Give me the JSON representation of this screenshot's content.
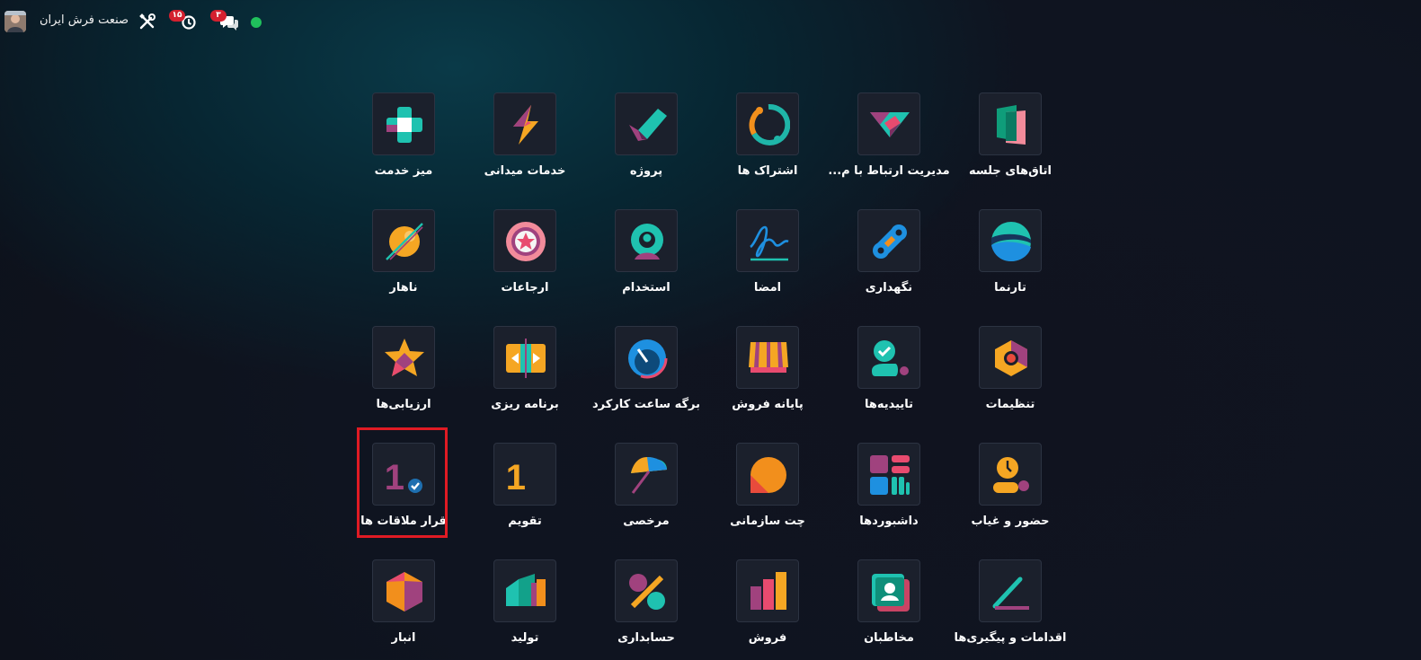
{
  "topbar": {
    "company": "صنعت فرش ایران",
    "chat_badge": "۳",
    "activity_badge": "۱۵",
    "status_color": "#20c05c",
    "icons": [
      "avatar",
      "tools-icon",
      "activity-icon",
      "chat-icon",
      "status-dot"
    ]
  },
  "apps": [
    {
      "label": "اتاق‌های جلسه",
      "icon": "meeting-rooms-icon"
    },
    {
      "label": "مدیریت ارتباط با م...",
      "icon": "crm-icon"
    },
    {
      "label": "اشتراک ها",
      "icon": "subscriptions-icon"
    },
    {
      "label": "پروژه",
      "icon": "project-icon"
    },
    {
      "label": "خدمات میدانی",
      "icon": "field-service-icon"
    },
    {
      "label": "میز خدمت",
      "icon": "helpdesk-icon"
    },
    {
      "label": "تارنما",
      "icon": "website-icon"
    },
    {
      "label": "نگهداری",
      "icon": "maintenance-icon"
    },
    {
      "label": "امضا",
      "icon": "sign-icon"
    },
    {
      "label": "استخدام",
      "icon": "recruitment-icon"
    },
    {
      "label": "ارجاعات",
      "icon": "referrals-icon"
    },
    {
      "label": "ناهار",
      "icon": "lunch-icon"
    },
    {
      "label": "تنظیمات",
      "icon": "settings-icon"
    },
    {
      "label": "تاییدیه‌ها",
      "icon": "approvals-icon"
    },
    {
      "label": "پایانه فروش",
      "icon": "point-of-sale-icon"
    },
    {
      "label": "برگه ساعت کارکرد",
      "icon": "timesheets-icon"
    },
    {
      "label": "برنامه ریزی",
      "icon": "planning-icon"
    },
    {
      "label": "ارزیابی‌ها",
      "icon": "appraisals-icon"
    },
    {
      "label": "حضور و غیاب",
      "icon": "attendances-icon"
    },
    {
      "label": "داشبوردها",
      "icon": "dashboards-icon"
    },
    {
      "label": "چت سازمانی",
      "icon": "discuss-icon"
    },
    {
      "label": "مرخصی",
      "icon": "time-off-icon"
    },
    {
      "label": "تقویم",
      "icon": "calendar-icon"
    },
    {
      "label": "قرار ملاقات ها",
      "icon": "appointments-icon"
    },
    {
      "label": "اقدامات و پیگیری‌ها",
      "icon": "activities-icon"
    },
    {
      "label": "مخاطبان",
      "icon": "contacts-icon"
    },
    {
      "label": "فروش",
      "icon": "sales-icon"
    },
    {
      "label": "حسابداری",
      "icon": "accounting-icon"
    },
    {
      "label": "تولید",
      "icon": "manufacturing-icon"
    },
    {
      "label": "انبار",
      "icon": "inventory-icon"
    }
  ],
  "selected_app": "قرار ملاقات ها",
  "highlight_color": "#e01b24"
}
